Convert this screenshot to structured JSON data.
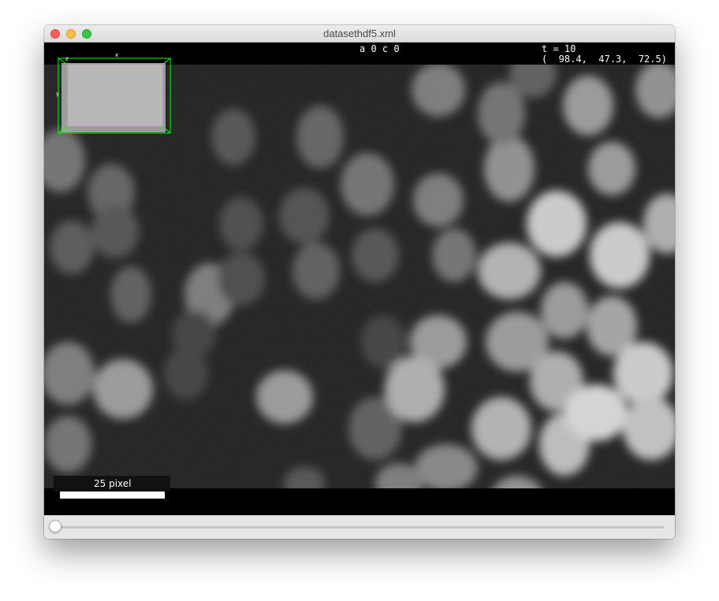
{
  "window": {
    "title": "datasethdf5.xml"
  },
  "overlay": {
    "setup_label": "a 0 c 0",
    "time_label": "t = 10",
    "coordinates": "(  98.4,  47.3,  72.5)"
  },
  "navigator": {
    "axis_x": "x",
    "axis_y": "y",
    "axis_z": "z",
    "box_color": "#00ff00"
  },
  "scalebar": {
    "label": "25 pixel"
  },
  "timeslider": {
    "position": 0
  },
  "icons": {
    "close": "close-traffic-light-icon",
    "minimize": "minimize-traffic-light-icon",
    "zoom": "zoom-traffic-light-icon"
  }
}
